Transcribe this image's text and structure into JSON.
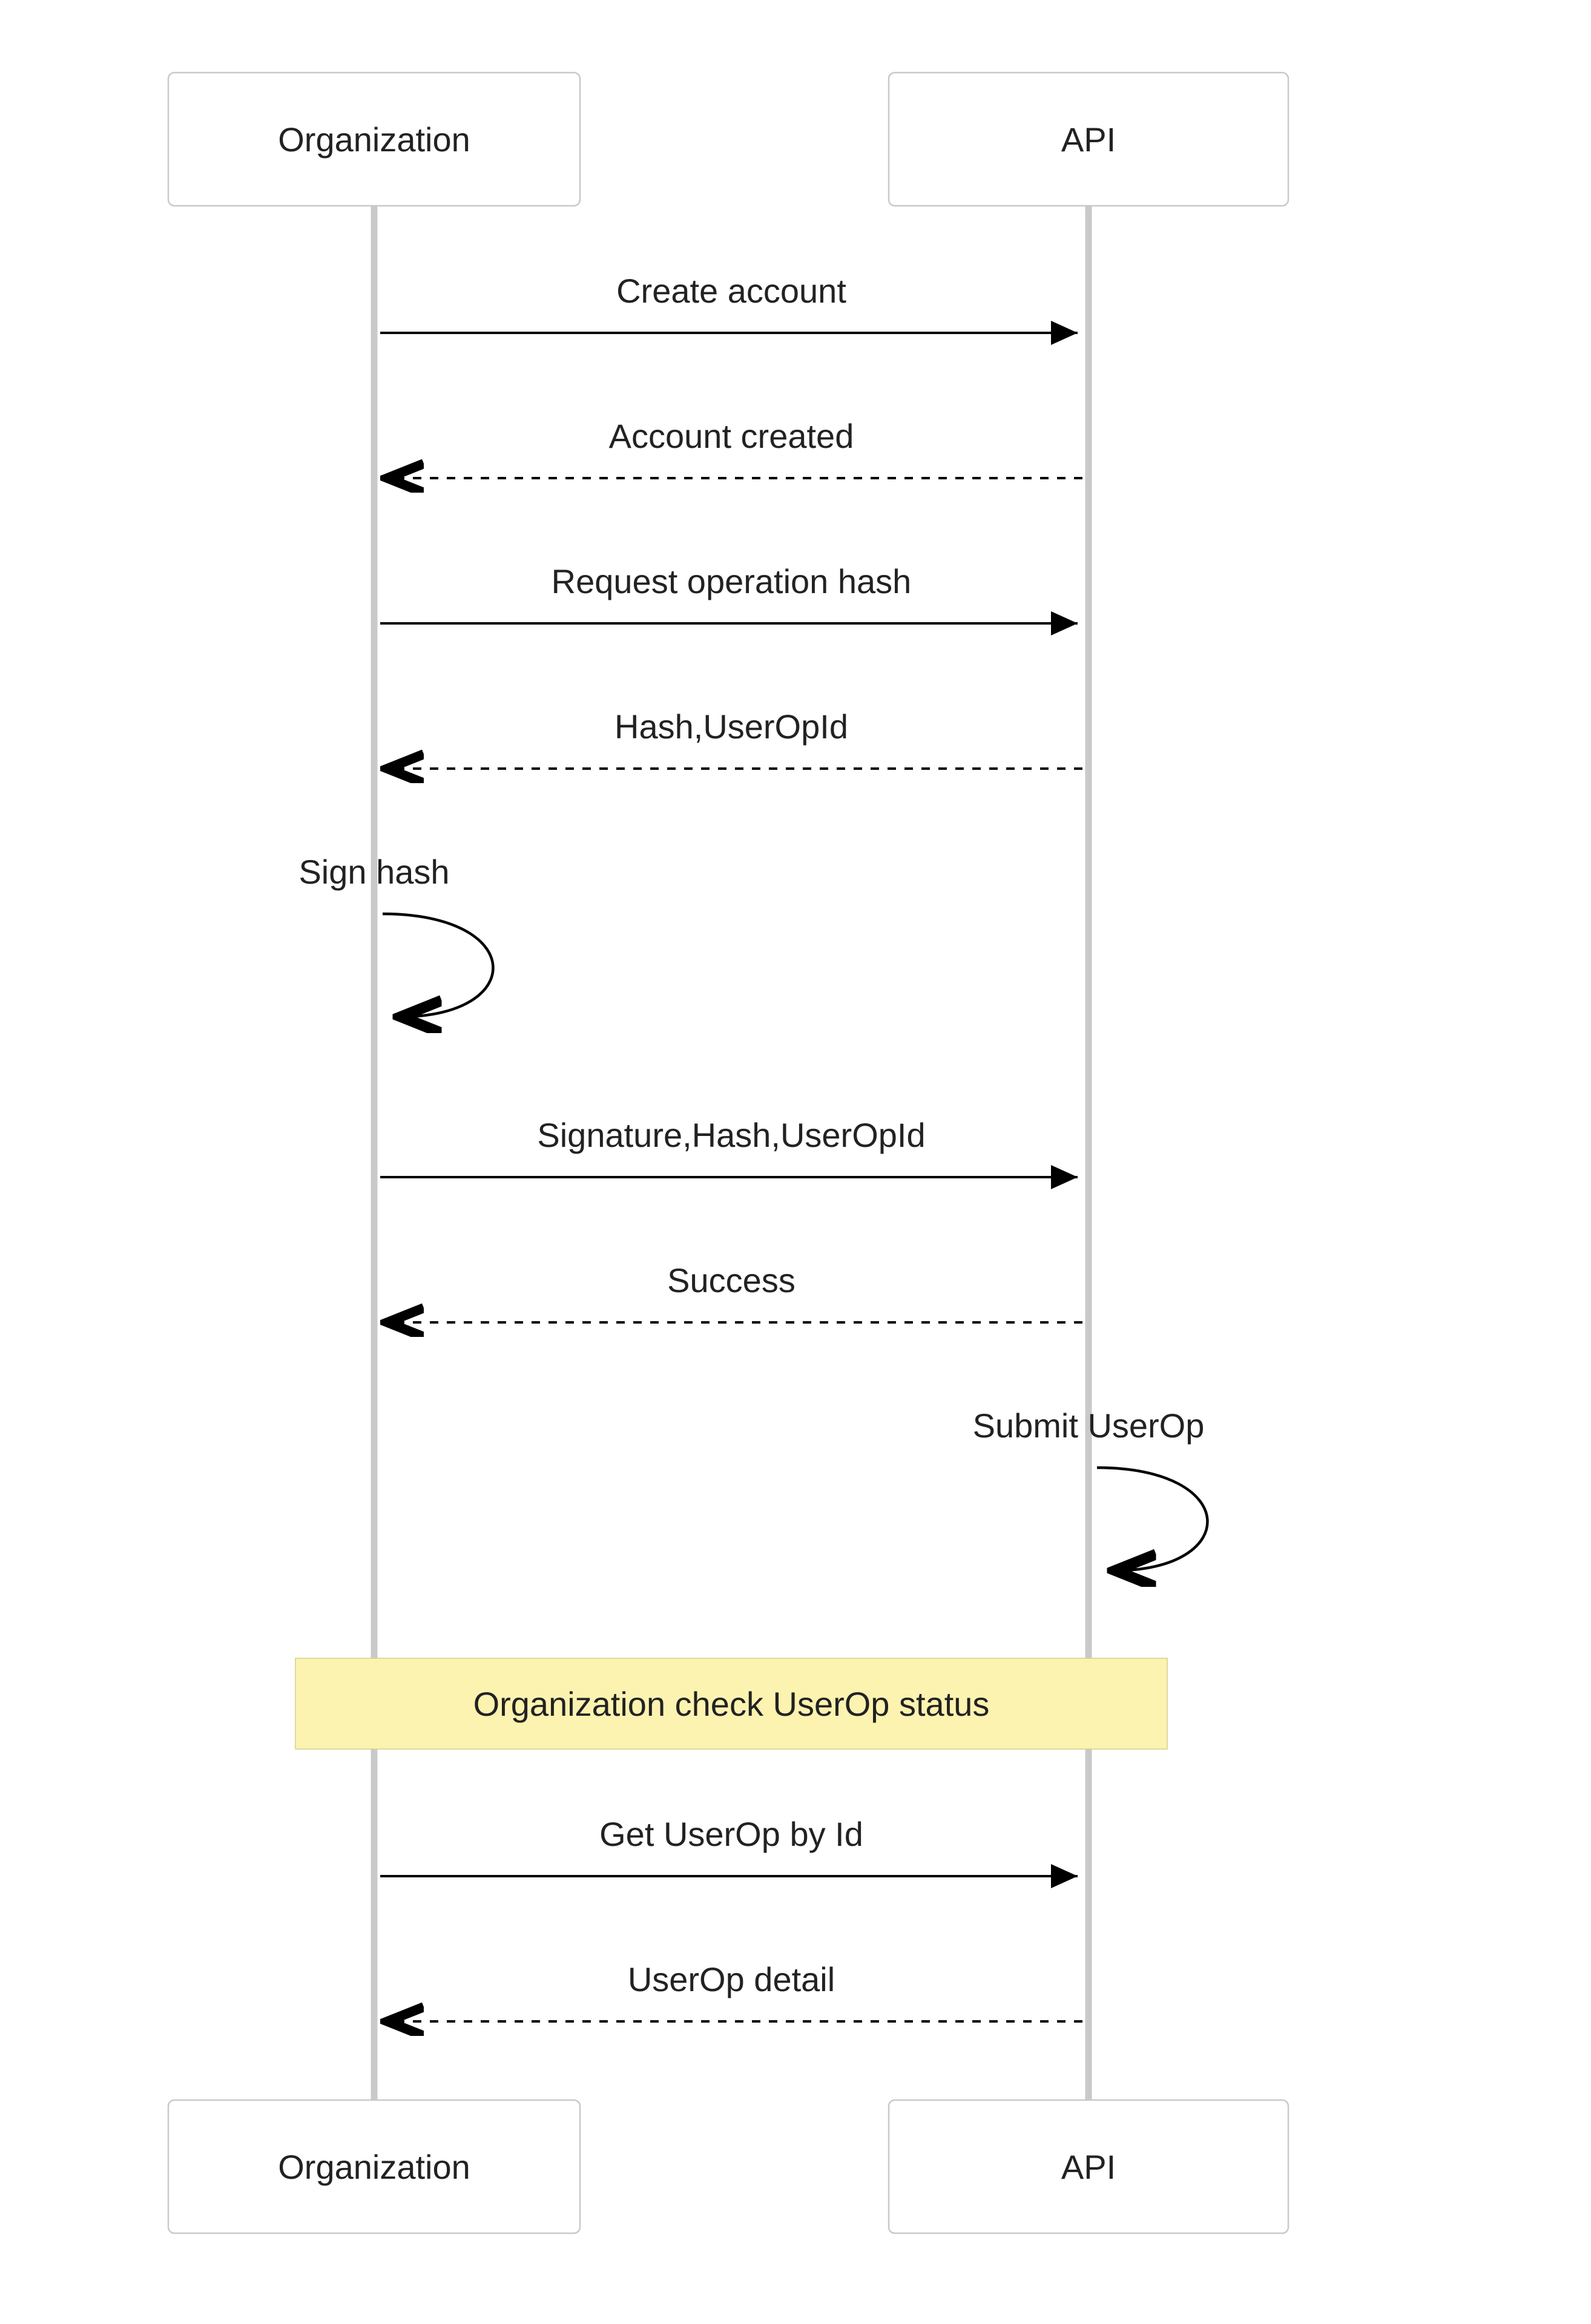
{
  "actors": {
    "left": "Organization",
    "right": "API"
  },
  "messages": {
    "m1": "Create account",
    "m2": "Account created",
    "m3": "Request operation hash",
    "m4": "Hash,UserOpId",
    "self_left": "Sign hash",
    "m5": "Signature,Hash,UserOpId",
    "m6": "Success",
    "self_right": "Submit UserOp",
    "m7": "Get UserOp by Id",
    "m8": "UserOp detail"
  },
  "note": "Organization check UserOp status"
}
